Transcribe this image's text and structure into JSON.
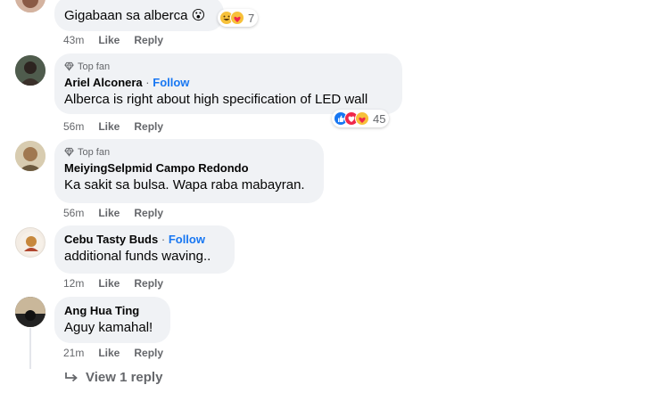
{
  "comments": [
    {
      "text": "Gigabaan sa alberca",
      "emoji": "😮",
      "time": "43m",
      "like": "Like",
      "reply": "Reply",
      "reaction_count": "7",
      "reaction_icons": [
        "haha-icon",
        "care-icon"
      ]
    },
    {
      "badge": "Top fan",
      "name": "Ariel Alconera",
      "follow": "Follow",
      "text": "Alberca is right about high specification of LED wall",
      "time": "56m",
      "like": "Like",
      "reply": "Reply",
      "reaction_count": "45",
      "reaction_icons": [
        "like-icon",
        "love-icon",
        "care-icon"
      ]
    },
    {
      "badge": "Top fan",
      "name": "MeiyingSelpmid Campo Redondo",
      "text": "Ka sakit sa bulsa. Wapa raba mabayran.",
      "time": "56m",
      "like": "Like",
      "reply": "Reply"
    },
    {
      "name": "Cebu Tasty Buds",
      "follow": "Follow",
      "text": "additional funds waving..",
      "time": "12m",
      "like": "Like",
      "reply": "Reply"
    },
    {
      "name": "Ang Hua Ting",
      "text": "Aguy kamahal!",
      "time": "21m",
      "like": "Like",
      "reply": "Reply"
    }
  ],
  "view_replies": "View 1 reply",
  "colors": {
    "bubble": "#f0f2f5",
    "meta": "#65676b",
    "follow": "#1877f2",
    "text": "#050505"
  }
}
